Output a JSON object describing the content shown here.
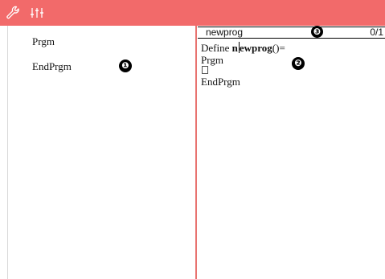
{
  "toolbar": {
    "background": "#f26a6a",
    "icons": [
      "wrench-icon",
      "sliders-icon"
    ]
  },
  "left_pane": {
    "lines": [
      "Prgm",
      "EndPrgm"
    ],
    "marker": "❶"
  },
  "right_pane": {
    "name_bar": {
      "program_name": "newprog",
      "marker": "❸",
      "line_counter": "0/1"
    },
    "define_prefix": "Define ",
    "define_name": "newprog",
    "define_suffix": "()=",
    "lines": [
      "Prgm",
      "EndPrgm"
    ],
    "marker": "❷"
  },
  "colors": {
    "divider": "#e8736f",
    "toolbar": "#f26a6a"
  }
}
